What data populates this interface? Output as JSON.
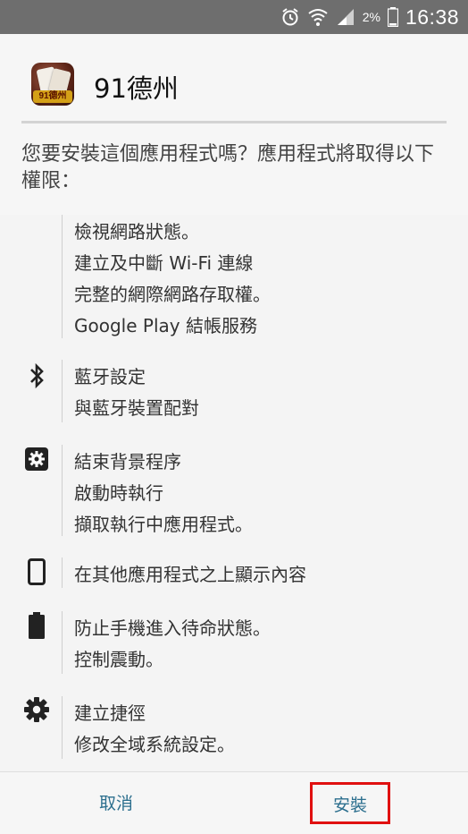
{
  "status_bar": {
    "battery_percent": "2%",
    "time": "16:38",
    "icons": [
      "alarm-icon",
      "wifi-icon",
      "signal-icon",
      "battery-icon"
    ]
  },
  "header": {
    "app_name": "91德州",
    "app_icon_text": "91德州",
    "prompt": "您要安裝這個應用程式嗎？應用程式將取得以下權限："
  },
  "permissions": {
    "groups": [
      {
        "icon": "none",
        "lines": [
          "檢視網路狀態。",
          "建立及中斷 Wi-Fi 連線",
          "完整的網際網路存取權。",
          "Google Play 結帳服務"
        ]
      },
      {
        "icon": "bluetooth-icon",
        "lines": [
          "藍牙設定",
          "與藍牙裝置配對"
        ]
      },
      {
        "icon": "settings-box-icon",
        "lines": [
          "結束背景程序",
          "啟動時執行",
          "擷取執行中應用程式。"
        ]
      },
      {
        "icon": "phone-icon",
        "lines": [
          "在其他應用程式之上顯示內容"
        ]
      },
      {
        "icon": "battery-icon",
        "lines": [
          "防止手機進入待命狀態。",
          "控制震動。"
        ]
      },
      {
        "icon": "gear-icon",
        "lines": [
          "建立捷徑",
          "修改全域系統設定。"
        ]
      }
    ]
  },
  "buttons": {
    "cancel": "取消",
    "install": "安裝"
  },
  "colors": {
    "status_bar": "#6e6e6e",
    "button_text": "#2c6f8e",
    "highlight": "#e01010"
  }
}
